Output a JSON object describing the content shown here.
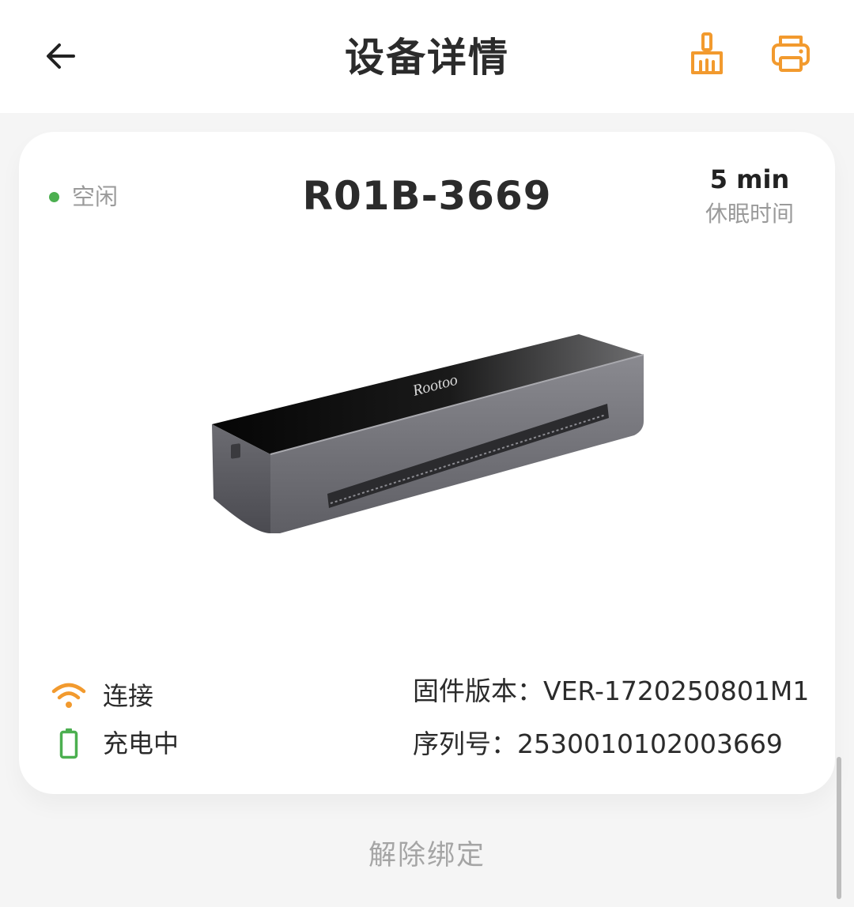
{
  "header": {
    "title": "设备详情",
    "back_icon": "arrow-left-icon",
    "clean_icon": "broom-icon",
    "print_icon": "printer-icon",
    "accent_color": "#f29a2e"
  },
  "device": {
    "status": "空闲",
    "status_color": "#4caf50",
    "name": "R01B-3669",
    "sleep_value": "5 min",
    "sleep_label": "休眠时间",
    "image_brand": "Rootoo"
  },
  "info": {
    "connection_label": "连接",
    "connection_icon": "wifi-icon",
    "battery_label": "充电中",
    "battery_icon": "battery-charging-icon",
    "battery_color": "#4caf50",
    "firmware": "固件版本：VER-1720250801M1",
    "serial": "序列号：2530010102003669"
  },
  "actions": {
    "unbind_label": "解除绑定"
  }
}
